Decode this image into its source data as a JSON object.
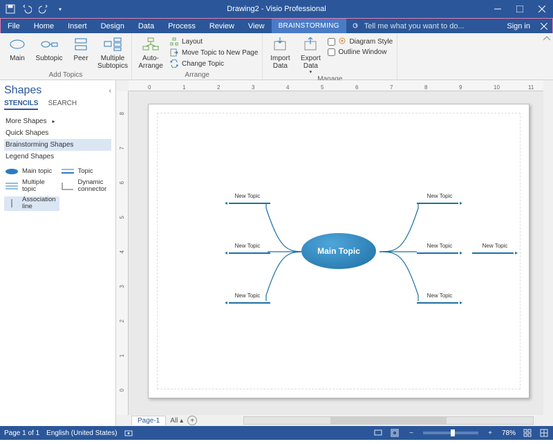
{
  "titlebar": {
    "title": "Drawing2 - Visio Professional"
  },
  "tabs": {
    "file": "File",
    "home": "Home",
    "insert": "Insert",
    "design": "Design",
    "data": "Data",
    "process": "Process",
    "review": "Review",
    "view": "View",
    "brainstorming": "BRAINSTORMING",
    "tellme": "Tell me what you want to do...",
    "signin": "Sign in"
  },
  "ribbon": {
    "add_topics": {
      "main": "Main",
      "subtopic": "Subtopic",
      "peer": "Peer",
      "multiple": "Multiple\nSubtopics",
      "label": "Add Topics"
    },
    "arrange": {
      "auto": "Auto-\nArrange",
      "layout": "Layout",
      "move_new_page": "Move Topic to New Page",
      "change_topic": "Change Topic",
      "label": "Arrange"
    },
    "manage": {
      "import": "Import\nData",
      "export": "Export\nData",
      "diagram_style": "Diagram Style",
      "outline_window": "Outline Window",
      "label": "Manage"
    }
  },
  "shapes": {
    "title": "Shapes",
    "stencils": "STENCILS",
    "search": "SEARCH",
    "more": "More Shapes",
    "quick": "Quick Shapes",
    "brainstorming": "Brainstorming Shapes",
    "legend": "Legend Shapes",
    "items": {
      "main_topic": "Main topic",
      "topic": "Topic",
      "multiple_topic": "Multiple\ntopic",
      "dynamic_connector": "Dynamic\nconnector",
      "association_line": "Association\nline"
    }
  },
  "canvas": {
    "main_topic_label": "Main Topic",
    "topics": [
      "New Topic",
      "New Topic",
      "New Topic",
      "New Topic",
      "New Topic",
      "New Topic",
      "New Topic"
    ],
    "page_tab": "Page-1",
    "all_tab": "All"
  },
  "ruler_h": [
    "0",
    "1",
    "2",
    "3",
    "4",
    "5",
    "6",
    "7",
    "8",
    "9",
    "10",
    "11"
  ],
  "ruler_v": [
    "8",
    "7",
    "6",
    "5",
    "4",
    "3",
    "2",
    "1",
    "0"
  ],
  "status": {
    "page": "Page 1 of 1",
    "lang": "English (United States)",
    "zoom": "78%"
  }
}
